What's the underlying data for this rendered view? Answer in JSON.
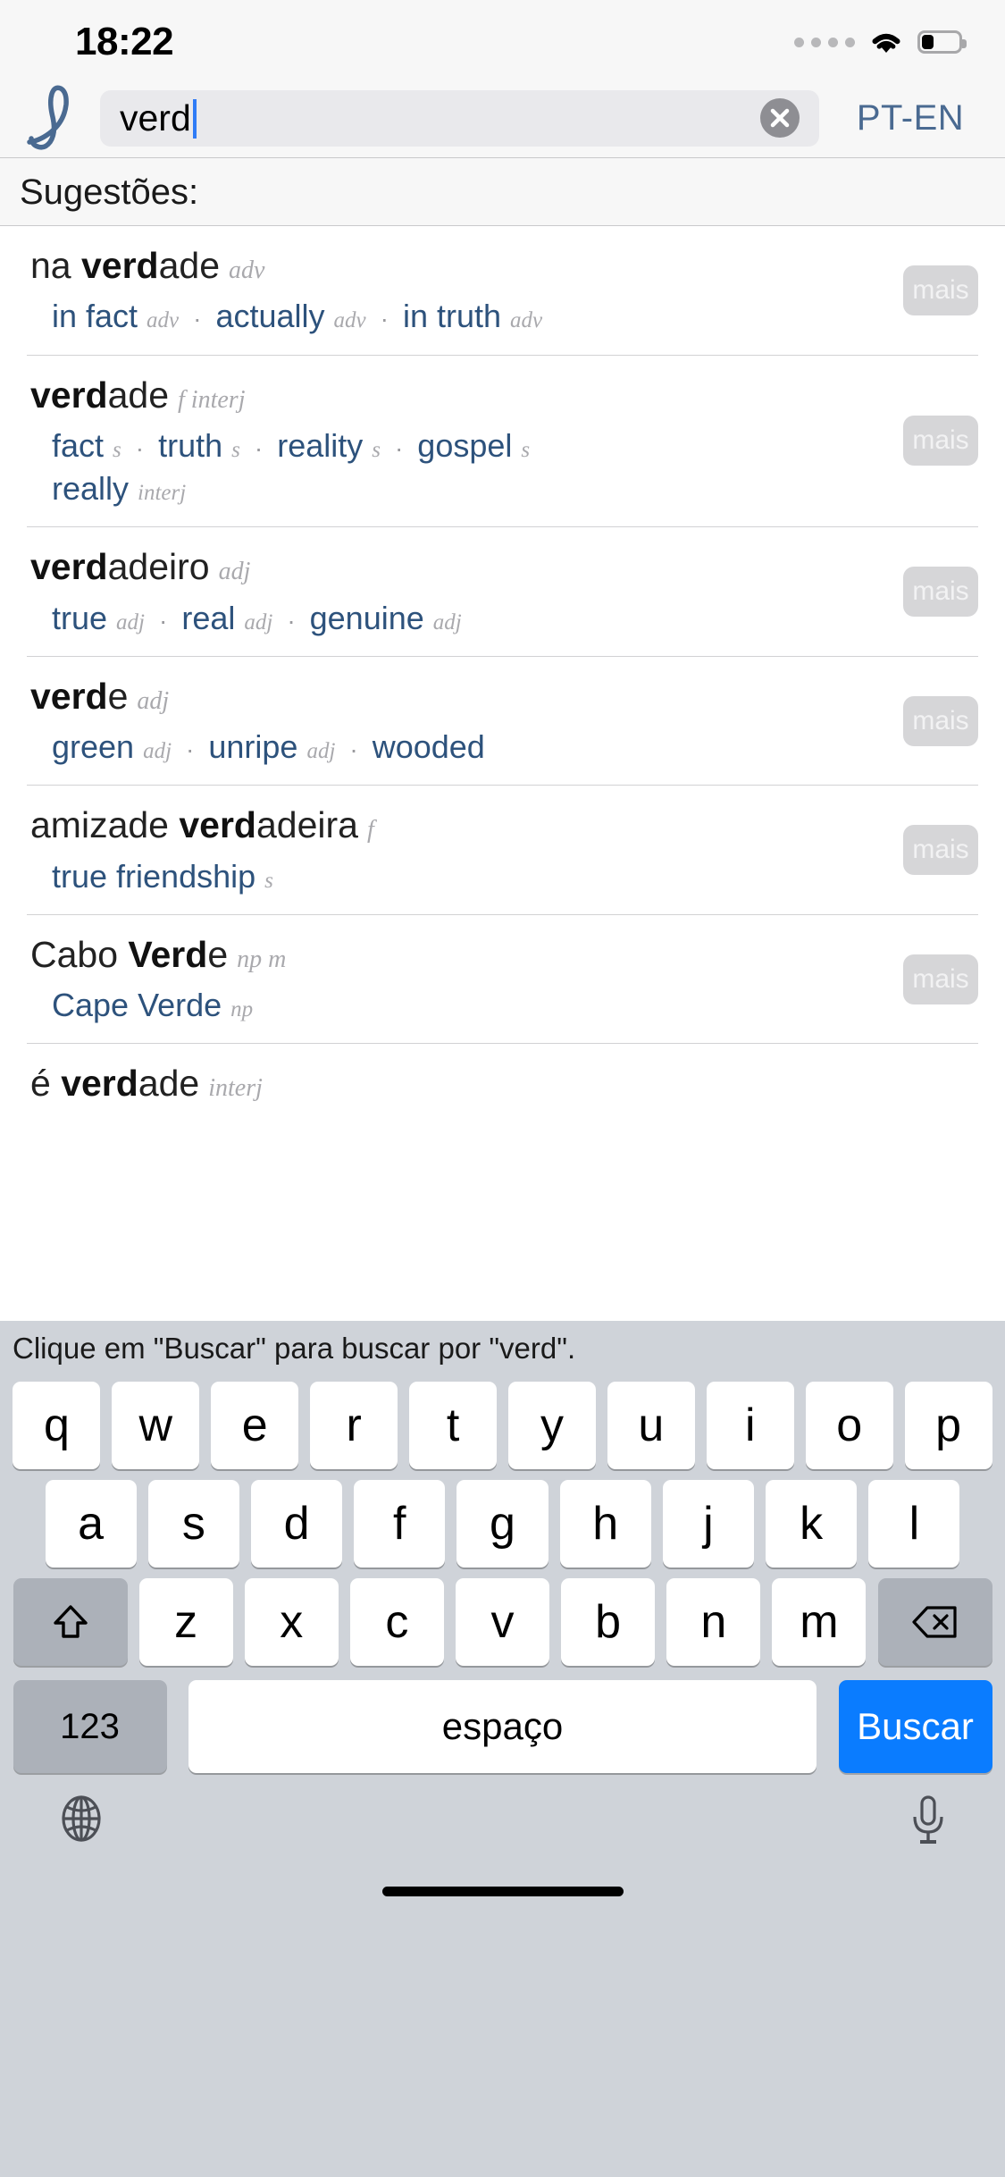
{
  "status_bar": {
    "time": "18:22",
    "signal_icon": "signal-dots-icon",
    "wifi_icon": "wifi-icon",
    "battery_icon": "battery-icon",
    "battery_level_pct": 30
  },
  "header": {
    "logo_icon": "linguee-l-logo",
    "search_value": "verd",
    "search_placeholder": "",
    "clear_icon": "clear-circle-icon",
    "language_pair": "PT-EN",
    "accent_color": "#2d527c",
    "logo_color": "#4a6a91"
  },
  "suggestions": {
    "header_label": "Sugestões:",
    "more_button_label": "mais",
    "entries": [
      {
        "head_pre": "na ",
        "head_bold": "verd",
        "head_post": "ade",
        "head_pos": "adv",
        "has_more": true,
        "translations": [
          {
            "text": "in fact",
            "pos": "adv"
          },
          {
            "text": "actually",
            "pos": "adv"
          },
          {
            "text": "in truth",
            "pos": "adv"
          }
        ]
      },
      {
        "head_pre": "",
        "head_bold": "verd",
        "head_post": "ade",
        "head_pos": "f interj",
        "has_more": true,
        "translations": [
          {
            "text": "fact",
            "pos": "s"
          },
          {
            "text": "truth",
            "pos": "s"
          },
          {
            "text": "reality",
            "pos": "s"
          },
          {
            "text": "gospel",
            "pos": "s"
          },
          {
            "text": "really",
            "pos": "interj",
            "newline": true
          }
        ]
      },
      {
        "head_pre": "",
        "head_bold": "verd",
        "head_post": "adeiro",
        "head_pos": "adj",
        "has_more": true,
        "translations": [
          {
            "text": "true",
            "pos": "adj"
          },
          {
            "text": "real",
            "pos": "adj"
          },
          {
            "text": "genuine",
            "pos": "adj"
          }
        ]
      },
      {
        "head_pre": "",
        "head_bold": "verd",
        "head_post": "e",
        "head_pos": "adj",
        "has_more": true,
        "translations": [
          {
            "text": "green",
            "pos": "adj"
          },
          {
            "text": "unripe",
            "pos": "adj"
          },
          {
            "text": "wooded",
            "pos": ""
          }
        ]
      },
      {
        "head_pre": "amizade ",
        "head_bold": "verd",
        "head_post": "adeira",
        "head_pos": "f",
        "has_more": true,
        "translations": [
          {
            "text": "true friendship",
            "pos": "s"
          }
        ]
      },
      {
        "head_pre": "Cabo ",
        "head_bold": "Verd",
        "head_post": "e",
        "head_pos": "np m",
        "has_more": true,
        "translations": [
          {
            "text": "Cape Verde",
            "pos": "np"
          }
        ]
      },
      {
        "head_pre": "é ",
        "head_bold": "verd",
        "head_post": "ade",
        "head_pos": "interj",
        "has_more": false,
        "translations": []
      }
    ]
  },
  "keyboard": {
    "hint": "Clique em \"Buscar\" para buscar por \"verd\".",
    "row1": [
      "q",
      "w",
      "e",
      "r",
      "t",
      "y",
      "u",
      "i",
      "o",
      "p"
    ],
    "row2": [
      "a",
      "s",
      "d",
      "f",
      "g",
      "h",
      "j",
      "k",
      "l"
    ],
    "row3": [
      "z",
      "x",
      "c",
      "v",
      "b",
      "n",
      "m"
    ],
    "shift_icon": "shift-arrow-icon",
    "backspace_icon": "backspace-icon",
    "numbers_label": "123",
    "space_label": "espaço",
    "search_label": "Buscar",
    "search_key_color": "#0a7cff",
    "globe_icon": "globe-icon",
    "mic_icon": "microphone-icon"
  }
}
